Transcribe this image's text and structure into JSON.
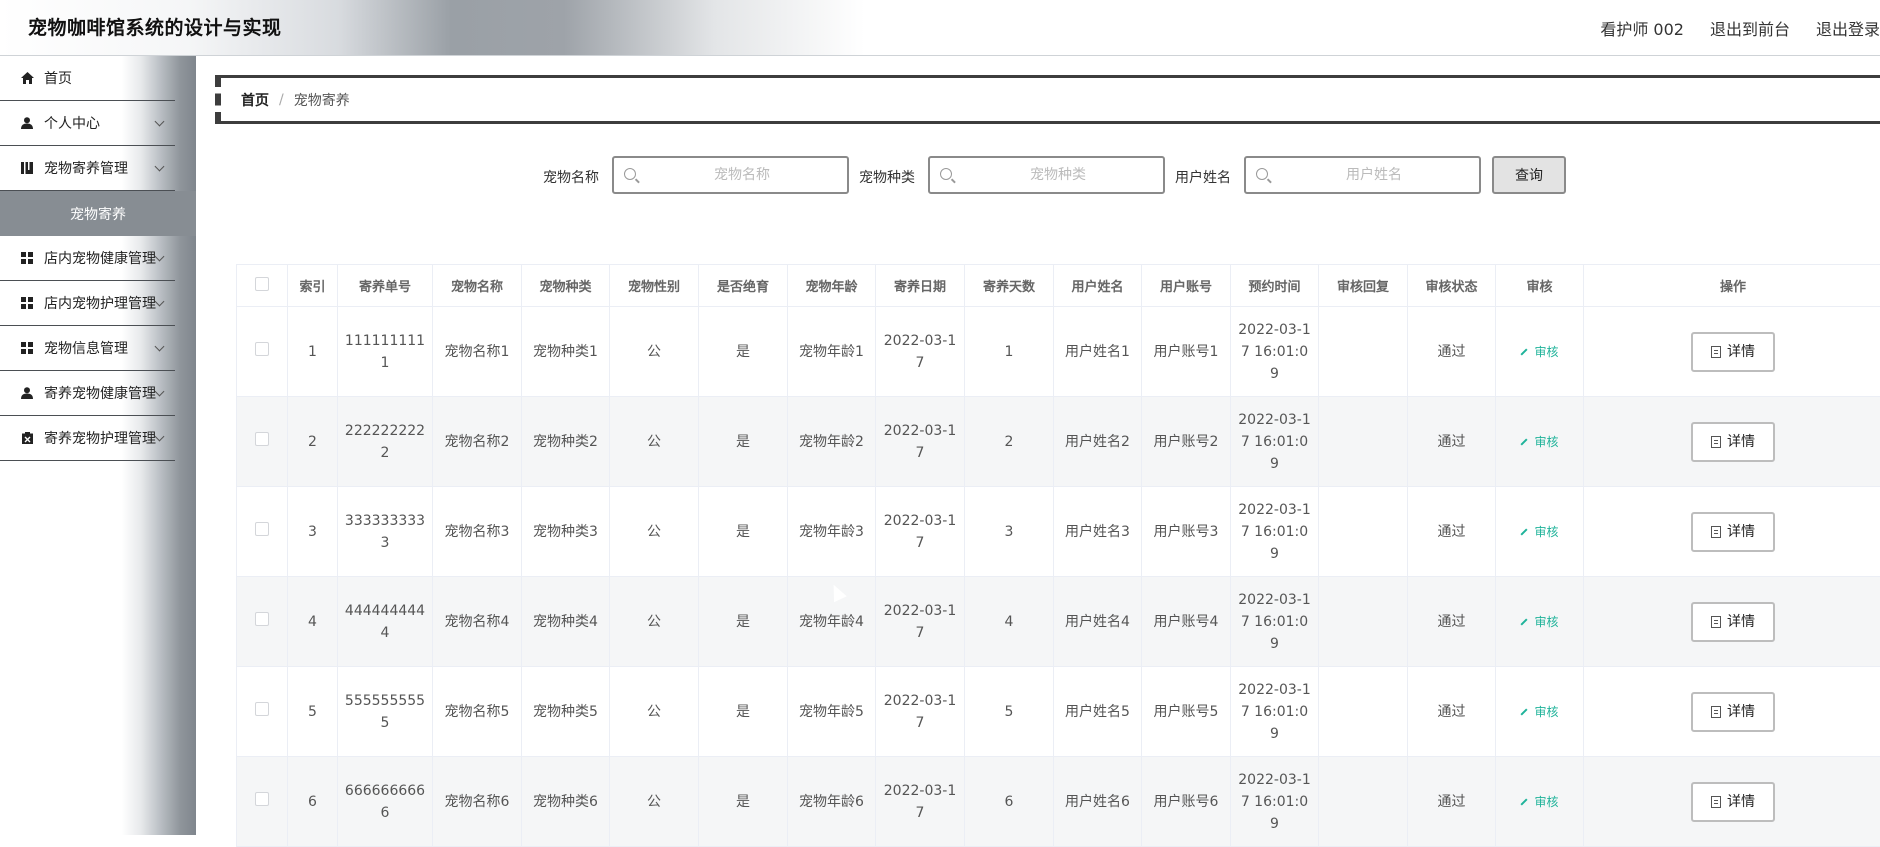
{
  "app": {
    "title": "宠物咖啡馆系统的设计与实现",
    "user": "看护师 002",
    "to_front": "退出到前台",
    "logout": "退出登录"
  },
  "sidebar": {
    "items": [
      {
        "label": "首页",
        "icon": "home-icon"
      },
      {
        "label": "个人中心",
        "icon": "user-icon"
      },
      {
        "label": "宠物寄养管理",
        "icon": "book-icon"
      },
      {
        "label": "宠物寄养",
        "icon": ""
      },
      {
        "label": "店内宠物健康管理",
        "icon": "grid-icon"
      },
      {
        "label": "店内宠物护理管理",
        "icon": "grid-icon"
      },
      {
        "label": "宠物信息管理",
        "icon": "grid-icon"
      },
      {
        "label": "寄养宠物健康管理",
        "icon": "user-icon"
      },
      {
        "label": "寄养宠物护理管理",
        "icon": "clipboard-icon"
      }
    ]
  },
  "breadcrumb": {
    "home": "首页",
    "separator": "/",
    "current": "宠物寄养"
  },
  "search": {
    "pet_name_label": "宠物名称",
    "pet_name_placeholder": "宠物名称",
    "pet_type_label": "宠物种类",
    "pet_type_placeholder": "宠物种类",
    "user_name_label": "用户姓名",
    "user_name_placeholder": "用户姓名",
    "query_button": "查询"
  },
  "table": {
    "headers": [
      "索引",
      "寄养单号",
      "宠物名称",
      "宠物种类",
      "宠物性别",
      "是否绝育",
      "宠物年龄",
      "寄养日期",
      "寄养天数",
      "用户姓名",
      "用户账号",
      "预约时间",
      "审核回复",
      "审核状态",
      "审核",
      "操作"
    ],
    "audit_label": "审核",
    "detail_label": "详情",
    "rows": [
      {
        "index": "1",
        "order_no": "1111111111",
        "name": "宠物名称1",
        "type": "宠物种类1",
        "gender": "公",
        "neutered": "是",
        "age": "宠物年龄1",
        "date": "2022-03-17",
        "days": "1",
        "user": "用户姓名1",
        "account": "用户账号1",
        "time": "2022-03-17 16:01:09",
        "reply": "",
        "status": "通过"
      },
      {
        "index": "2",
        "order_no": "2222222222",
        "name": "宠物名称2",
        "type": "宠物种类2",
        "gender": "公",
        "neutered": "是",
        "age": "宠物年龄2",
        "date": "2022-03-17",
        "days": "2",
        "user": "用户姓名2",
        "account": "用户账号2",
        "time": "2022-03-17 16:01:09",
        "reply": "",
        "status": "通过"
      },
      {
        "index": "3",
        "order_no": "3333333333",
        "name": "宠物名称3",
        "type": "宠物种类3",
        "gender": "公",
        "neutered": "是",
        "age": "宠物年龄3",
        "date": "2022-03-17",
        "days": "3",
        "user": "用户姓名3",
        "account": "用户账号3",
        "time": "2022-03-17 16:01:09",
        "reply": "",
        "status": "通过"
      },
      {
        "index": "4",
        "order_no": "4444444444",
        "name": "宠物名称4",
        "type": "宠物种类4",
        "gender": "公",
        "neutered": "是",
        "age": "宠物年龄4",
        "date": "2022-03-17",
        "days": "4",
        "user": "用户姓名4",
        "account": "用户账号4",
        "time": "2022-03-17 16:01:09",
        "reply": "",
        "status": "通过"
      },
      {
        "index": "5",
        "order_no": "5555555555",
        "name": "宠物名称5",
        "type": "宠物种类5",
        "gender": "公",
        "neutered": "是",
        "age": "宠物年龄5",
        "date": "2022-03-17",
        "days": "5",
        "user": "用户姓名5",
        "account": "用户账号5",
        "time": "2022-03-17 16:01:09",
        "reply": "",
        "status": "通过"
      },
      {
        "index": "6",
        "order_no": "6666666666",
        "name": "宠物名称6",
        "type": "宠物种类6",
        "gender": "公",
        "neutered": "是",
        "age": "宠物年龄6",
        "date": "2022-03-17",
        "days": "6",
        "user": "用户姓名6",
        "account": "用户账号6",
        "time": "2022-03-17 16:01:09",
        "reply": "",
        "status": "通过"
      }
    ]
  },
  "colors": {
    "accent": "#1fb39a",
    "selected_sidebar": "#878d93"
  }
}
